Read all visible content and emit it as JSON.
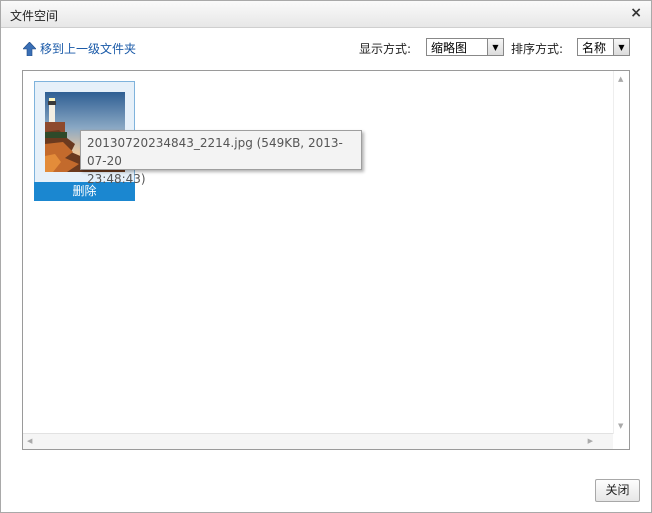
{
  "dialog": {
    "title": "文件空间",
    "close_glyph": "×"
  },
  "toolbar": {
    "up_label": "移到上一级文件夹",
    "up_icon": "arrow-up-icon",
    "display_label": "显示方式:",
    "display_value": "缩略图",
    "sort_label": "排序方式:",
    "sort_value": "名称"
  },
  "files": [
    {
      "delete_label": "删除",
      "tooltip_line1": "20130720234843_2214.jpg (549KB, 2013-07-20",
      "tooltip_line2": "23:48:43)"
    }
  ],
  "footer": {
    "close_label": "关闭"
  },
  "colors": {
    "accent": "#1b87d0",
    "link": "#1a5aa8"
  }
}
